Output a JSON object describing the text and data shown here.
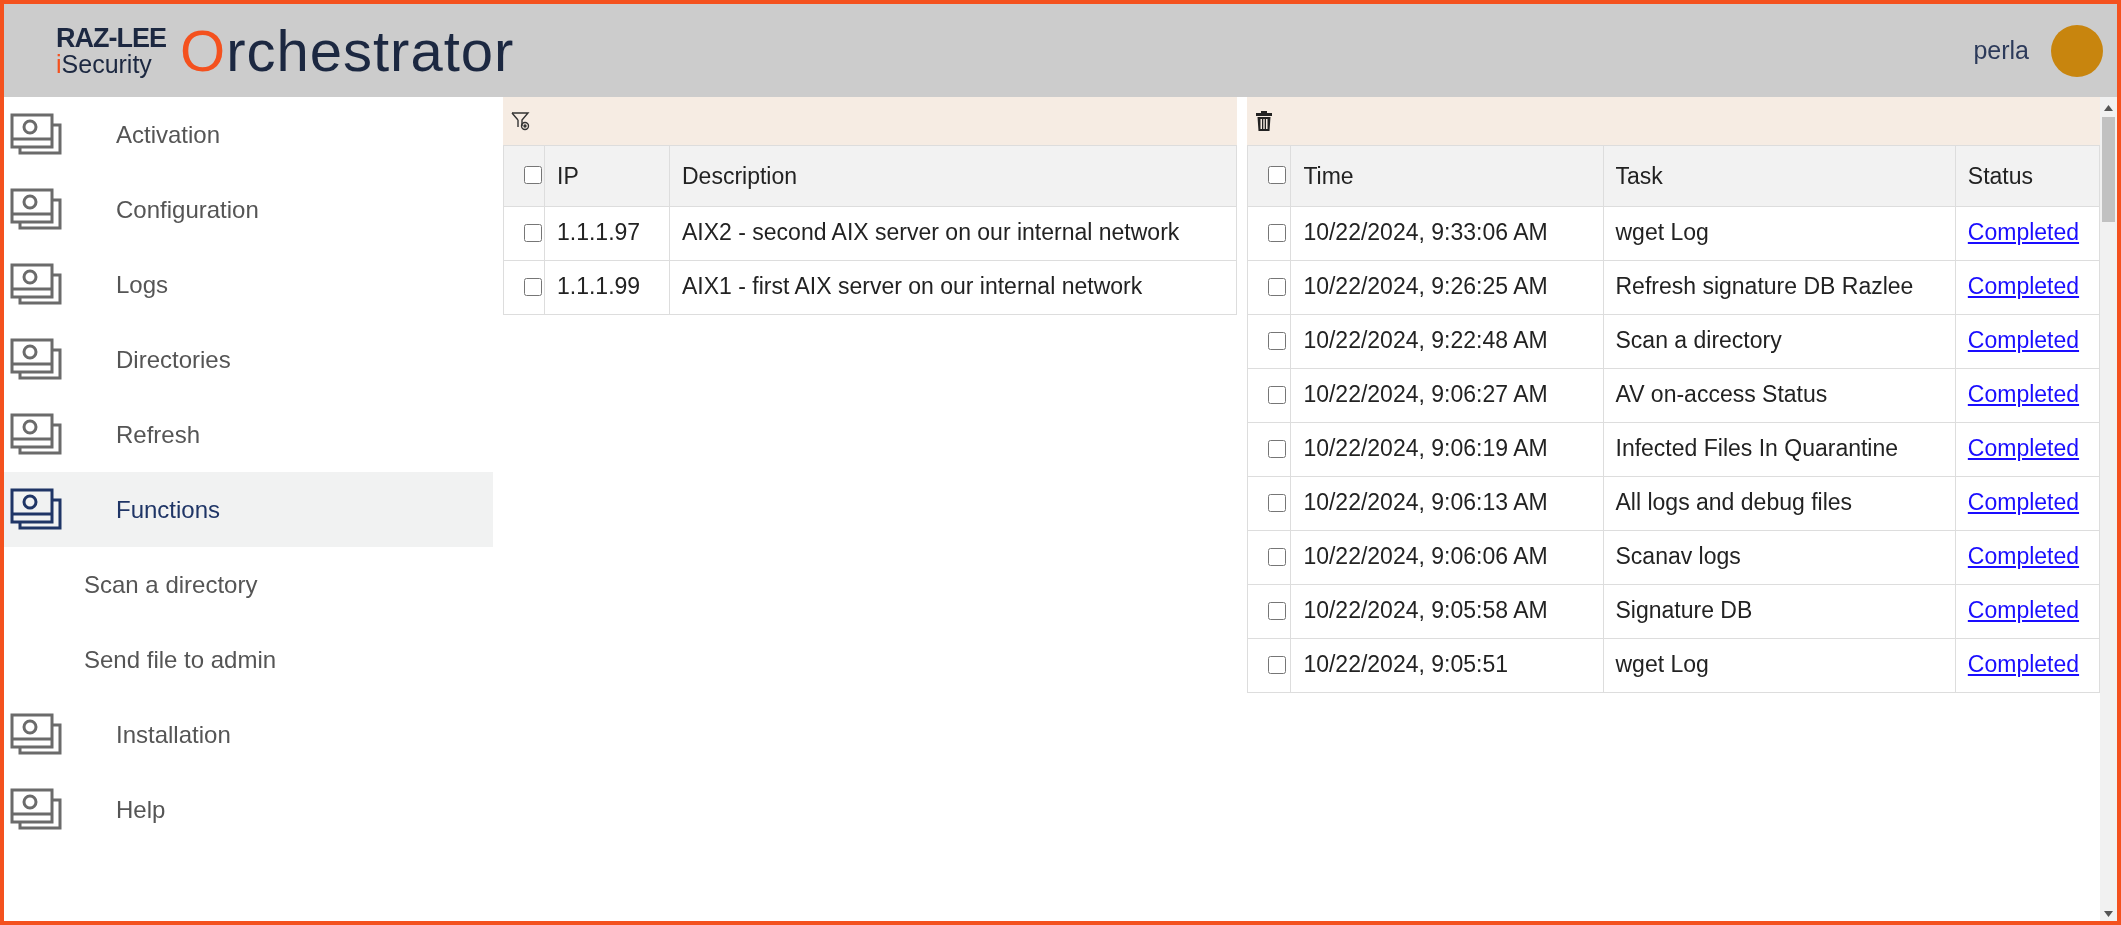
{
  "header": {
    "logo": {
      "brand_top": "RAZ-LEE",
      "brand_bottom": "iSecurity",
      "product": "Orchestrator"
    },
    "user": {
      "name": "perla"
    }
  },
  "sidebar": {
    "items": [
      {
        "label": "Activation",
        "selected": false
      },
      {
        "label": "Configuration",
        "selected": false
      },
      {
        "label": "Logs",
        "selected": false
      },
      {
        "label": "Directories",
        "selected": false
      },
      {
        "label": "Refresh",
        "selected": false
      },
      {
        "label": "Functions",
        "selected": true,
        "children": [
          {
            "label": "Scan a directory"
          },
          {
            "label": "Send file to admin"
          }
        ]
      },
      {
        "label": "Installation",
        "selected": false
      },
      {
        "label": "Help",
        "selected": false
      }
    ]
  },
  "hosts_table": {
    "select_all_checked": false,
    "columns": [
      "IP",
      "Description"
    ],
    "rows": [
      {
        "checked": false,
        "ip": "1.1.1.97",
        "description": "AIX2 - second AIX server on our internal network"
      },
      {
        "checked": false,
        "ip": "1.1.1.99",
        "description": "AIX1 - first AIX server on our internal network"
      }
    ]
  },
  "tasks_table": {
    "select_all_checked": false,
    "columns": [
      "Time",
      "Task",
      "Status"
    ],
    "rows": [
      {
        "checked": false,
        "time": "10/22/2024, 9:33:06 AM",
        "task": "wget Log",
        "status": "Completed"
      },
      {
        "checked": false,
        "time": "10/22/2024, 9:26:25 AM",
        "task": "Refresh signature DB Razlee",
        "status": "Completed"
      },
      {
        "checked": false,
        "time": "10/22/2024, 9:22:48 AM",
        "task": "Scan a directory",
        "status": "Completed"
      },
      {
        "checked": false,
        "time": "10/22/2024, 9:06:27 AM",
        "task": "AV on-access Status",
        "status": "Completed"
      },
      {
        "checked": false,
        "time": "10/22/2024, 9:06:19 AM",
        "task": "Infected Files In Quarantine",
        "status": "Completed"
      },
      {
        "checked": false,
        "time": "10/22/2024, 9:06:13 AM",
        "task": "All logs and debug files",
        "status": "Completed"
      },
      {
        "checked": false,
        "time": "10/22/2024, 9:06:06 AM",
        "task": "Scanav logs",
        "status": "Completed"
      },
      {
        "checked": false,
        "time": "10/22/2024, 9:05:58 AM",
        "task": "Signature DB",
        "status": "Completed"
      },
      {
        "checked": false,
        "time": "10/22/2024, 9:05:51",
        "task": "wget Log",
        "status": "Completed"
      }
    ]
  }
}
